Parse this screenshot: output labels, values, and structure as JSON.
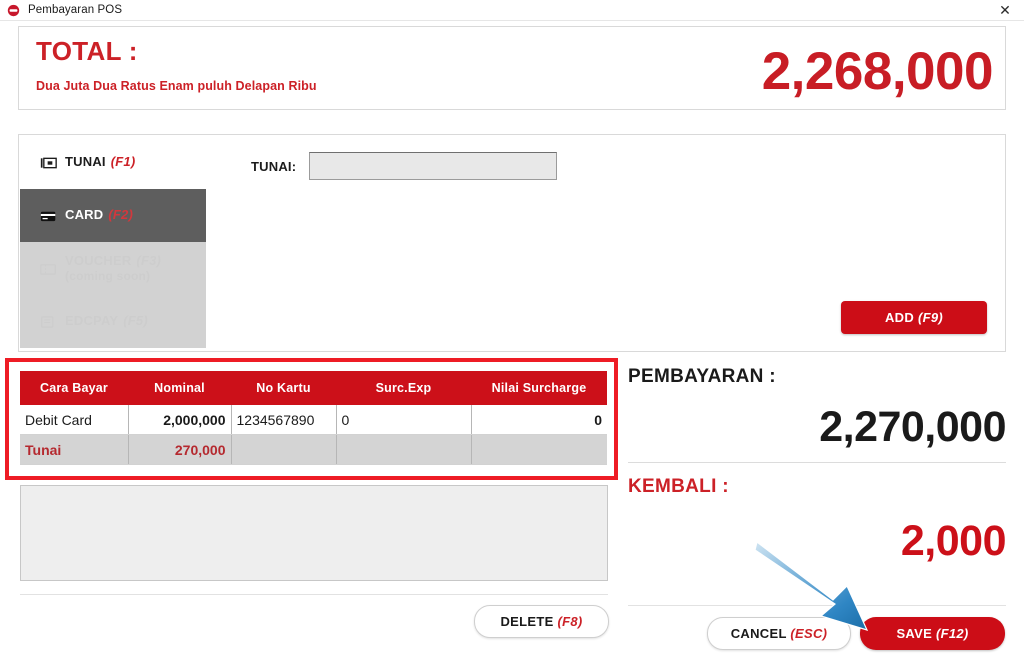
{
  "window": {
    "title": "Pembayaran POS",
    "icon": "app-logo-icon",
    "close_label": "✕"
  },
  "total": {
    "label": "TOTAL :",
    "words": "Dua Juta Dua Ratus Enam puluh Delapan Ribu",
    "amount": "2,268,000",
    "color": "#c81d25"
  },
  "methods": {
    "tabs": [
      {
        "label": "TUNAI",
        "fkey": "(F1)",
        "icon": "cash-icon",
        "state": "normal",
        "sub": ""
      },
      {
        "label": "CARD",
        "fkey": "(F2)",
        "icon": "credit-card-icon",
        "state": "active",
        "sub": ""
      },
      {
        "label": "VOUCHER",
        "fkey": "(F3)",
        "icon": "voucher-icon",
        "state": "disabled",
        "sub": "(coming soon)"
      },
      {
        "label": "EDCPAY",
        "fkey": "(F5)",
        "icon": "edcpay-icon",
        "state": "disabled",
        "sub": ""
      }
    ],
    "field": {
      "label": "TUNAI:",
      "value": "",
      "placeholder": ""
    },
    "add_button": {
      "label": "ADD",
      "fkey": "(F9)"
    }
  },
  "payment_table": {
    "columns": [
      "Cara Bayar",
      "Nominal",
      "No Kartu",
      "Surc.Exp",
      "Nilai Surcharge"
    ],
    "rows": [
      {
        "cara_bayar": "Debit Card",
        "nominal": "2,000,000",
        "no_kartu": "1234567890",
        "surc_exp": "0",
        "nilai_surcharge": "0"
      },
      {
        "cara_bayar": "Tunai",
        "nominal": "270,000",
        "no_kartu": "",
        "surc_exp": "",
        "nilai_surcharge": ""
      }
    ],
    "highlight_color": "#ee1c25",
    "header_color": "#cc1019"
  },
  "summary": {
    "pembayaran_label": "PEMBAYARAN :",
    "pembayaran_value": "2,270,000",
    "kembali_label": "KEMBALI :",
    "kembali_value": "2,000",
    "kembali_color": "#cc1019"
  },
  "actions": {
    "delete": {
      "label": "DELETE",
      "fkey": "(F8)"
    },
    "cancel": {
      "label": "CANCEL",
      "fkey": "(ESC)"
    },
    "save": {
      "label": "SAVE",
      "fkey": "(F12)"
    }
  },
  "annotation": {
    "arrow": "blue-arrow-pointing-to-save-button",
    "color": "#3d8fc6"
  }
}
